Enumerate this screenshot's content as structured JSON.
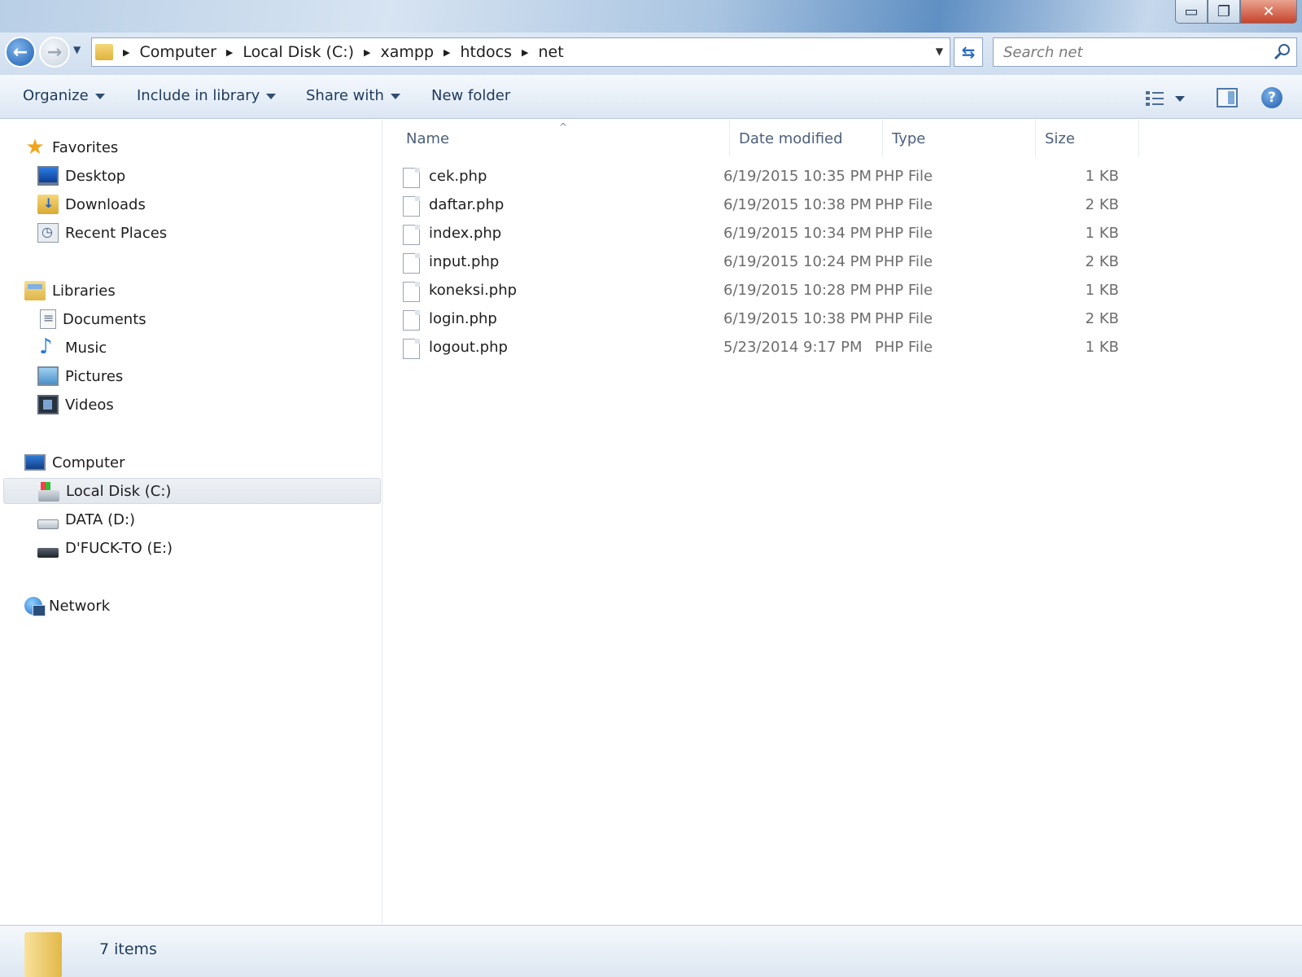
{
  "window": {
    "minimize_glyph": "▭",
    "restore_glyph": "❐",
    "close_glyph": "✕"
  },
  "address": {
    "crumbs": [
      "Computer",
      "Local Disk (C:)",
      "xampp",
      "htdocs",
      "net"
    ]
  },
  "search": {
    "placeholder": "Search net"
  },
  "toolbar": {
    "organize": "Organize",
    "include_in_library": "Include in library",
    "share_with": "Share with",
    "new_folder": "New folder",
    "help_glyph": "?"
  },
  "sidebar": {
    "favorites": "Favorites",
    "desktop": "Desktop",
    "downloads": "Downloads",
    "recent_places": "Recent Places",
    "libraries": "Libraries",
    "documents": "Documents",
    "music": "Music",
    "pictures": "Pictures",
    "videos": "Videos",
    "computer": "Computer",
    "local_disk": "Local Disk (C:)",
    "data_drive": "DATA (D:)",
    "dfuck_drive": "D'FUCK-TO (E:)",
    "network": "Network"
  },
  "columns": {
    "name": "Name",
    "date_modified": "Date modified",
    "type": "Type",
    "size": "Size"
  },
  "files": [
    {
      "name": "cek.php",
      "date": "6/19/2015 10:35 PM",
      "type": "PHP File",
      "size": "1 KB"
    },
    {
      "name": "daftar.php",
      "date": "6/19/2015 10:38 PM",
      "type": "PHP File",
      "size": "2 KB"
    },
    {
      "name": "index.php",
      "date": "6/19/2015 10:34 PM",
      "type": "PHP File",
      "size": "1 KB"
    },
    {
      "name": "input.php",
      "date": "6/19/2015 10:24 PM",
      "type": "PHP File",
      "size": "2 KB"
    },
    {
      "name": "koneksi.php",
      "date": "6/19/2015 10:28 PM",
      "type": "PHP File",
      "size": "1 KB"
    },
    {
      "name": "login.php",
      "date": "6/19/2015 10:38 PM",
      "type": "PHP File",
      "size": "2 KB"
    },
    {
      "name": "logout.php",
      "date": "5/23/2014 9:17 PM",
      "type": "PHP File",
      "size": "1 KB"
    }
  ],
  "status": {
    "item_count": "7 items"
  }
}
